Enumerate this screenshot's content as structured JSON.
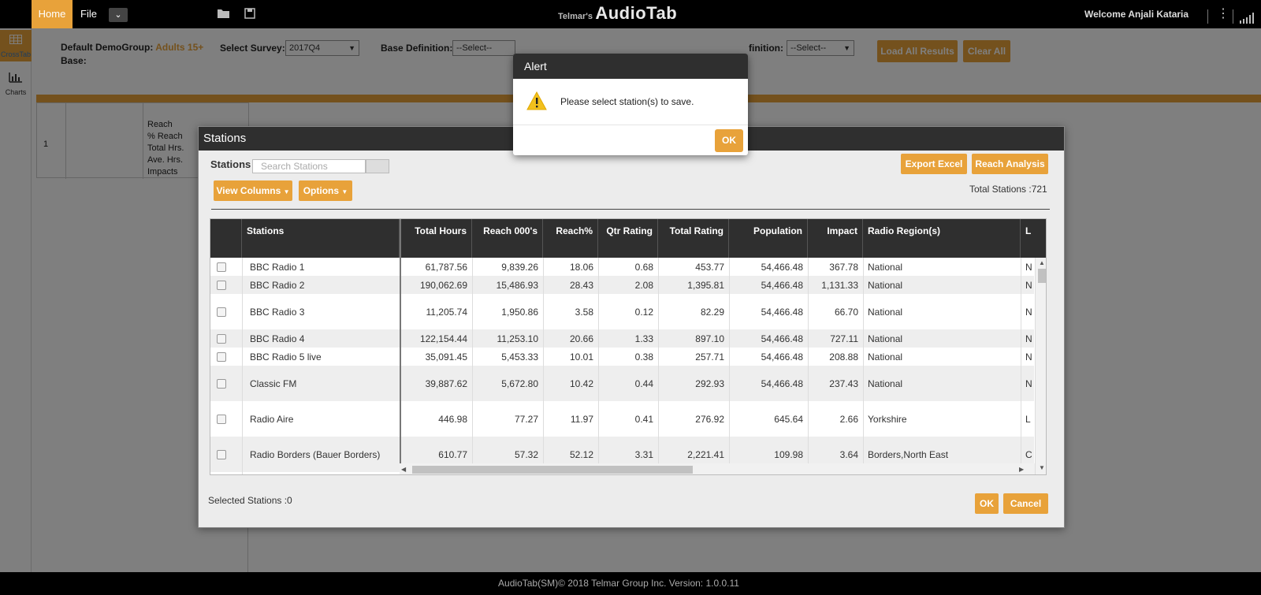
{
  "header": {
    "tab_home": "Home",
    "tab_file": "File",
    "dropdown_icon": "chevron-down-icon",
    "brand_small": "Telmar's",
    "brand_big": "AudioTab",
    "welcome": "Welcome Anjali Kataria"
  },
  "sidebar": {
    "items": [
      {
        "label": "CrossTab",
        "icon": "table-icon"
      },
      {
        "label": "Charts",
        "icon": "bar-chart-icon"
      }
    ]
  },
  "filters": {
    "demo_label": "Default DemoGroup:",
    "demo_value": "Adults 15+",
    "base_label": "Base:",
    "survey_label": "Select Survey:",
    "survey_value": "2017Q4",
    "base_def_label": "Base Definition:",
    "base_def_value": "--Select--",
    "definition_label": "finition:",
    "definition_value": "--Select--",
    "load_all": "Load All Results",
    "clear_all": "Clear All"
  },
  "bg_table": {
    "row_num": "1",
    "metrics": [
      "Reach",
      "% Reach",
      "Total Hrs.",
      "Ave. Hrs.",
      "Impacts"
    ]
  },
  "stations_modal": {
    "title": "Stations",
    "stations_label": "Stations",
    "search_placeholder": "Search Stations",
    "view_columns": "View Columns",
    "options": "Options",
    "export_excel": "Export Excel",
    "reach_analysis": "Reach Analysis",
    "total_stations": "Total Stations :721",
    "selected_stations": "Selected Stations :0",
    "ok": "OK",
    "cancel": "Cancel",
    "columns": [
      "Stations",
      "Total Hours",
      "Reach 000's",
      "Reach%",
      "Qtr Rating",
      "Total Rating",
      "Population",
      "Impact",
      "Radio Region(s)",
      "L"
    ],
    "rows": [
      {
        "name": "BBC Radio 1",
        "total_hours": "61,787.56",
        "reach": "9,839.26",
        "reach_pct": "18.06",
        "qtr": "0.68",
        "total_rating": "453.77",
        "population": "54,466.48",
        "impact": "367.78",
        "region": "National",
        "extra": "N"
      },
      {
        "name": "BBC Radio 2",
        "total_hours": "190,062.69",
        "reach": "15,486.93",
        "reach_pct": "28.43",
        "qtr": "2.08",
        "total_rating": "1,395.81",
        "population": "54,466.48",
        "impact": "1,131.33",
        "region": "National",
        "extra": "N"
      },
      {
        "name": "BBC Radio 3",
        "total_hours": "11,205.74",
        "reach": "1,950.86",
        "reach_pct": "3.58",
        "qtr": "0.12",
        "total_rating": "82.29",
        "population": "54,466.48",
        "impact": "66.70",
        "region": "National",
        "extra": "N"
      },
      {
        "name": "BBC Radio 4",
        "total_hours": "122,154.44",
        "reach": "11,253.10",
        "reach_pct": "20.66",
        "qtr": "1.33",
        "total_rating": "897.10",
        "population": "54,466.48",
        "impact": "727.11",
        "region": "National",
        "extra": "N"
      },
      {
        "name": "BBC Radio 5 live",
        "total_hours": "35,091.45",
        "reach": "5,453.33",
        "reach_pct": "10.01",
        "qtr": "0.38",
        "total_rating": "257.71",
        "population": "54,466.48",
        "impact": "208.88",
        "region": "National",
        "extra": "N"
      },
      {
        "name": "Classic FM",
        "total_hours": "39,887.62",
        "reach": "5,672.80",
        "reach_pct": "10.42",
        "qtr": "0.44",
        "total_rating": "292.93",
        "population": "54,466.48",
        "impact": "237.43",
        "region": "National",
        "extra": "N"
      },
      {
        "name": "Radio Aire",
        "total_hours": "446.98",
        "reach": "77.27",
        "reach_pct": "11.97",
        "qtr": "0.41",
        "total_rating": "276.92",
        "population": "645.64",
        "impact": "2.66",
        "region": "Yorkshire",
        "extra": "L"
      },
      {
        "name": "Radio Borders (Bauer Borders)",
        "total_hours": "610.77",
        "reach": "57.32",
        "reach_pct": "52.12",
        "qtr": "3.31",
        "total_rating": "2,221.41",
        "population": "109.98",
        "impact": "3.64",
        "region": "Borders,North East",
        "extra": "C"
      }
    ]
  },
  "alert": {
    "title": "Alert",
    "message": "Please select station(s) to save.",
    "ok": "OK",
    "icon": "warning-icon"
  },
  "footer": {
    "text": "AudioTab(SM)© 2018 Telmar Group Inc. Version: 1.0.0.11"
  },
  "colors": {
    "accent": "#e8a23a",
    "header_bg": "#000000",
    "dark_panel": "#2f2f2f"
  }
}
